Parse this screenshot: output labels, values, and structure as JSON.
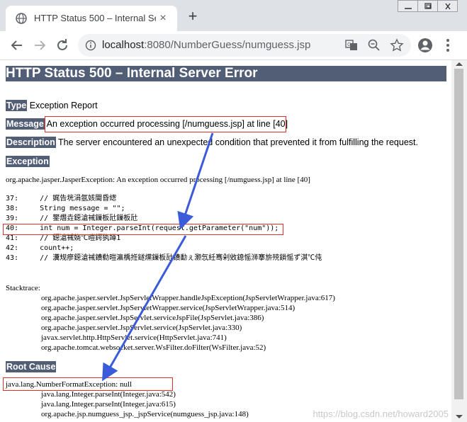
{
  "browser": {
    "tab_title": "HTTP Status 500 – Internal Ser",
    "tab_close": "×",
    "new_tab": "+",
    "url_host": "localhost",
    "url_rest": ":8080/NumberGuess/numguess.jsp"
  },
  "page": {
    "heading": "HTTP Status 500 – Internal Server Error",
    "type_label": "Type",
    "type_value": "Exception Report",
    "message_label": "Message",
    "message_value": "An exception occurred processing [/numguess.jsp] at line [40]",
    "description_label": "Description",
    "description_value": "The server encountered an unexpected condition that prevented it from fulfilling the request.",
    "exception_label": "Exception",
    "exception_text": "org.apache.jasper.JasperException: An exception occurred processing [/numguess.jsp] at line [40]",
    "code_lines": [
      "37:     // 娓告垙涓氬姟閫昏緫",
      "38:     String message = \"\";",
      "39:     // 鐢熸垚鐚滄祴鏁板瓧鏁板瓧",
      "40:     int num = Integer.parseInt(request.getParameter(\"num\"));",
      "41:     // 鐚滄祴娆℃暟鍔犱竴1",
      "42:     count++;",
      "43:     // 瀵规瘮鐚滄祴鐨勬暟瀛楀拰鐩爣鏁板瓧鐨勫ぇ灏忥紝骞剁敓鎴愮浉搴旂殑鎻愮ず淇℃伅"
    ],
    "stacktrace_label": "Stacktrace:",
    "stack_lines": [
      "org.apache.jasper.servlet.JspServletWrapper.handleJspException(JspServletWrapper.java:617)",
      "org.apache.jasper.servlet.JspServletWrapper.service(JspServletWrapper.java:514)",
      "org.apache.jasper.servlet.JspServlet.serviceJspFile(JspServlet.java:386)",
      "org.apache.jasper.servlet.JspServlet.service(JspServlet.java:330)",
      "javax.servlet.http.HttpServlet.service(HttpServlet.java:741)",
      "org.apache.tomcat.websocket.server.WsFilter.doFilter(WsFilter.java:52)"
    ],
    "root_cause_label": "Root Cause",
    "root_cause_text": "java.lang.NumberFormatException: null",
    "root_lines": [
      "java.lang.Integer.parseInt(Integer.java:542)",
      "java.lang.Integer.parseInt(Integer.java:615)",
      "org.apache.jsp.numguess_jsp._jspService(numguess_jsp.java:148)"
    ],
    "watermark": "https://blog.csdn.net/howard2005"
  },
  "colors": {
    "tomcat_label_bg": "#525d76",
    "annotation_red": "#e0302a",
    "annotation_arrow": "#3b5bdb"
  }
}
